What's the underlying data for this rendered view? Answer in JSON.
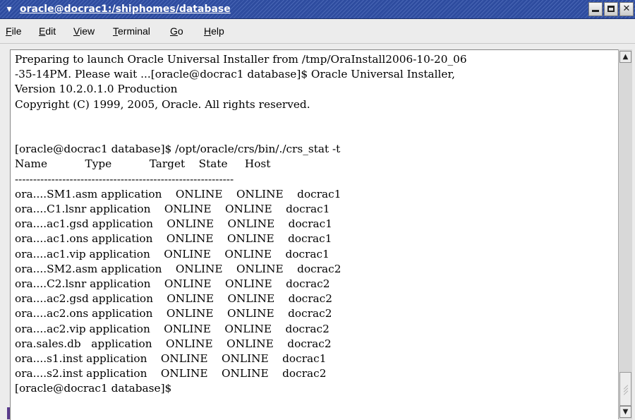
{
  "window": {
    "title": "oracle@docrac1:/shiphomes/database",
    "menu_glyph": "▾"
  },
  "menubar": {
    "items": [
      {
        "accel": "F",
        "rest": "ile"
      },
      {
        "accel": "E",
        "rest": "dit"
      },
      {
        "accel": "V",
        "rest": "iew"
      },
      {
        "accel": "T",
        "rest": "erminal"
      },
      {
        "accel": "G",
        "rest": "o"
      },
      {
        "accel": "H",
        "rest": "elp"
      }
    ]
  },
  "terminal": {
    "lines": [
      "Preparing to launch Oracle Universal Installer from /tmp/OraInstall2006-10-20_06",
      "-35-14PM. Please wait ...[oracle@docrac1 database]$ Oracle Universal Installer,",
      "Version 10.2.0.1.0 Production",
      "Copyright (C) 1999, 2005, Oracle. All rights reserved.",
      "",
      "",
      "[oracle@docrac1 database]$ /opt/oracle/crs/bin/./crs_stat -t",
      "Name           Type           Target    State     Host",
      "------------------------------------------------------------",
      "ora....SM1.asm application    ONLINE    ONLINE    docrac1",
      "ora....C1.lsnr application    ONLINE    ONLINE    docrac1",
      "ora....ac1.gsd application    ONLINE    ONLINE    docrac1",
      "ora....ac1.ons application    ONLINE    ONLINE    docrac1",
      "ora....ac1.vip application    ONLINE    ONLINE    docrac1",
      "ora....SM2.asm application    ONLINE    ONLINE    docrac2",
      "ora....C2.lsnr application    ONLINE    ONLINE    docrac2",
      "ora....ac2.gsd application    ONLINE    ONLINE    docrac2",
      "ora....ac2.ons application    ONLINE    ONLINE    docrac2",
      "ora....ac2.vip application    ONLINE    ONLINE    docrac2",
      "ora.sales.db   application    ONLINE    ONLINE    docrac2",
      "ora....s1.inst application    ONLINE    ONLINE    docrac1",
      "ora....s2.inst application    ONLINE    ONLINE    docrac2",
      "[oracle@docrac1 database]$ "
    ]
  },
  "scrollbar": {
    "up_glyph": "▲",
    "down_glyph": "▼"
  },
  "icons": {
    "window_menu": "chevron-down-icon",
    "minimize": "minimize-icon",
    "maximize": "maximize-icon",
    "close": "close-icon"
  }
}
